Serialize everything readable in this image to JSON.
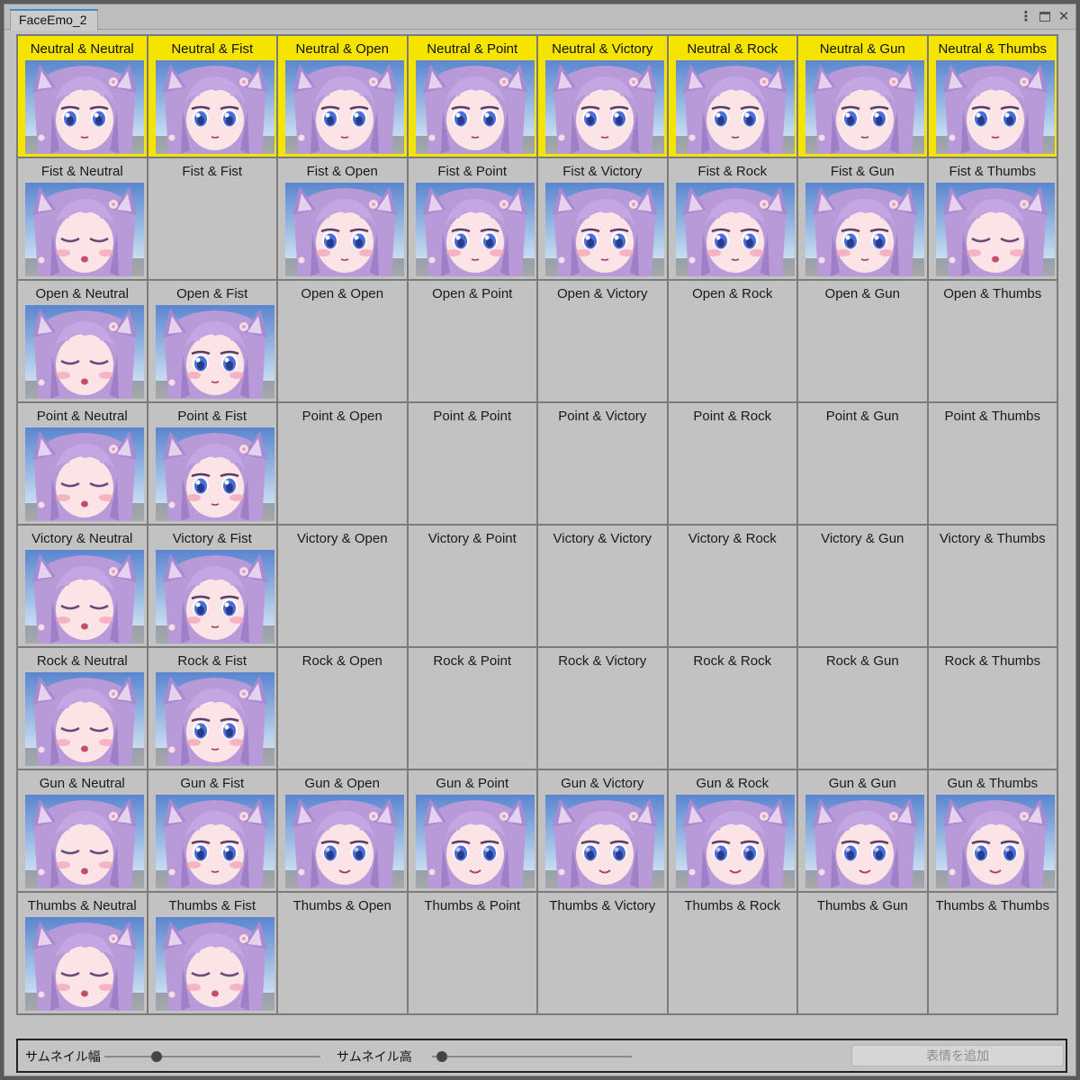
{
  "window": {
    "tab_title": "FaceEmo_2",
    "controls": [
      "kebab-menu-icon",
      "maximize-icon",
      "close-icon"
    ]
  },
  "colors": {
    "default_highlight": "#f5e400",
    "cell_background": "#c2c2c2",
    "grid_lines": "#7b7b7b"
  },
  "grid": {
    "cells": [
      {
        "label": "Neutral & Neutral",
        "thumbnail": true,
        "expression": "open-eyes",
        "default": true
      },
      {
        "label": "Neutral & Fist",
        "thumbnail": true,
        "expression": "open-eyes",
        "default": true
      },
      {
        "label": "Neutral & Open",
        "thumbnail": true,
        "expression": "open-eyes",
        "default": true
      },
      {
        "label": "Neutral & Point",
        "thumbnail": true,
        "expression": "open-eyes",
        "default": true
      },
      {
        "label": "Neutral & Victory",
        "thumbnail": true,
        "expression": "open-eyes",
        "default": true
      },
      {
        "label": "Neutral & Rock",
        "thumbnail": true,
        "expression": "open-eyes",
        "default": true
      },
      {
        "label": "Neutral & Gun",
        "thumbnail": true,
        "expression": "open-eyes",
        "default": true
      },
      {
        "label": "Neutral & Thumbs",
        "thumbnail": true,
        "expression": "open-eyes",
        "default": true
      },
      {
        "label": "Fist & Neutral",
        "thumbnail": true,
        "expression": "closed-eyes",
        "default": false
      },
      {
        "label": "Fist & Fist",
        "thumbnail": false,
        "expression": "",
        "default": false
      },
      {
        "label": "Fist & Open",
        "thumbnail": true,
        "expression": "blush",
        "default": false
      },
      {
        "label": "Fist & Point",
        "thumbnail": true,
        "expression": "blush",
        "default": false
      },
      {
        "label": "Fist & Victory",
        "thumbnail": true,
        "expression": "blush",
        "default": false
      },
      {
        "label": "Fist & Rock",
        "thumbnail": true,
        "expression": "blush",
        "default": false
      },
      {
        "label": "Fist & Gun",
        "thumbnail": true,
        "expression": "blush",
        "default": false
      },
      {
        "label": "Fist & Thumbs",
        "thumbnail": true,
        "expression": "closed-eyes",
        "default": false
      },
      {
        "label": "Open & Neutral",
        "thumbnail": true,
        "expression": "closed-eyes",
        "default": false
      },
      {
        "label": "Open & Fist",
        "thumbnail": true,
        "expression": "blush",
        "default": false
      },
      {
        "label": "Open & Open",
        "thumbnail": false,
        "expression": "",
        "default": false
      },
      {
        "label": "Open & Point",
        "thumbnail": false,
        "expression": "",
        "default": false
      },
      {
        "label": "Open & Victory",
        "thumbnail": false,
        "expression": "",
        "default": false
      },
      {
        "label": "Open & Rock",
        "thumbnail": false,
        "expression": "",
        "default": false
      },
      {
        "label": "Open & Gun",
        "thumbnail": false,
        "expression": "",
        "default": false
      },
      {
        "label": "Open & Thumbs",
        "thumbnail": false,
        "expression": "",
        "default": false
      },
      {
        "label": "Point & Neutral",
        "thumbnail": true,
        "expression": "closed-eyes",
        "default": false
      },
      {
        "label": "Point & Fist",
        "thumbnail": true,
        "expression": "blush",
        "default": false
      },
      {
        "label": "Point & Open",
        "thumbnail": false,
        "expression": "",
        "default": false
      },
      {
        "label": "Point & Point",
        "thumbnail": false,
        "expression": "",
        "default": false
      },
      {
        "label": "Point & Victory",
        "thumbnail": false,
        "expression": "",
        "default": false
      },
      {
        "label": "Point & Rock",
        "thumbnail": false,
        "expression": "",
        "default": false
      },
      {
        "label": "Point & Gun",
        "thumbnail": false,
        "expression": "",
        "default": false
      },
      {
        "label": "Point & Thumbs",
        "thumbnail": false,
        "expression": "",
        "default": false
      },
      {
        "label": "Victory & Neutral",
        "thumbnail": true,
        "expression": "closed-eyes",
        "default": false
      },
      {
        "label": "Victory & Fist",
        "thumbnail": true,
        "expression": "blush",
        "default": false
      },
      {
        "label": "Victory & Open",
        "thumbnail": false,
        "expression": "",
        "default": false
      },
      {
        "label": "Victory & Point",
        "thumbnail": false,
        "expression": "",
        "default": false
      },
      {
        "label": "Victory & Victory",
        "thumbnail": false,
        "expression": "",
        "default": false
      },
      {
        "label": "Victory & Rock",
        "thumbnail": false,
        "expression": "",
        "default": false
      },
      {
        "label": "Victory & Gun",
        "thumbnail": false,
        "expression": "",
        "default": false
      },
      {
        "label": "Victory & Thumbs",
        "thumbnail": false,
        "expression": "",
        "default": false
      },
      {
        "label": "Rock & Neutral",
        "thumbnail": true,
        "expression": "closed-eyes",
        "default": false
      },
      {
        "label": "Rock & Fist",
        "thumbnail": true,
        "expression": "blush",
        "default": false
      },
      {
        "label": "Rock & Open",
        "thumbnail": false,
        "expression": "",
        "default": false
      },
      {
        "label": "Rock & Point",
        "thumbnail": false,
        "expression": "",
        "default": false
      },
      {
        "label": "Rock & Victory",
        "thumbnail": false,
        "expression": "",
        "default": false
      },
      {
        "label": "Rock & Rock",
        "thumbnail": false,
        "expression": "",
        "default": false
      },
      {
        "label": "Rock & Gun",
        "thumbnail": false,
        "expression": "",
        "default": false
      },
      {
        "label": "Rock & Thumbs",
        "thumbnail": false,
        "expression": "",
        "default": false
      },
      {
        "label": "Gun & Neutral",
        "thumbnail": true,
        "expression": "closed-eyes",
        "default": false
      },
      {
        "label": "Gun & Fist",
        "thumbnail": true,
        "expression": "blush",
        "default": false
      },
      {
        "label": "Gun & Open",
        "thumbnail": true,
        "expression": "smile",
        "default": false
      },
      {
        "label": "Gun & Point",
        "thumbnail": true,
        "expression": "smile",
        "default": false
      },
      {
        "label": "Gun & Victory",
        "thumbnail": true,
        "expression": "smile",
        "default": false
      },
      {
        "label": "Gun & Rock",
        "thumbnail": true,
        "expression": "smile",
        "default": false
      },
      {
        "label": "Gun & Gun",
        "thumbnail": true,
        "expression": "smile",
        "default": false
      },
      {
        "label": "Gun & Thumbs",
        "thumbnail": true,
        "expression": "smile",
        "default": false
      },
      {
        "label": "Thumbs & Neutral",
        "thumbnail": true,
        "expression": "closed-eyes",
        "default": false
      },
      {
        "label": "Thumbs & Fist",
        "thumbnail": true,
        "expression": "closed-eyes",
        "default": false
      },
      {
        "label": "Thumbs & Open",
        "thumbnail": false,
        "expression": "",
        "default": false
      },
      {
        "label": "Thumbs & Point",
        "thumbnail": false,
        "expression": "",
        "default": false
      },
      {
        "label": "Thumbs & Victory",
        "thumbnail": false,
        "expression": "",
        "default": false
      },
      {
        "label": "Thumbs & Rock",
        "thumbnail": false,
        "expression": "",
        "default": false
      },
      {
        "label": "Thumbs & Gun",
        "thumbnail": false,
        "expression": "",
        "default": false
      },
      {
        "label": "Thumbs & Thumbs",
        "thumbnail": false,
        "expression": "",
        "default": false
      }
    ]
  },
  "toolbar": {
    "width_label": "サムネイル幅",
    "height_label": "サムネイル高",
    "width_slider_value": 0.24,
    "height_slider_value": 0.05,
    "add_button_label": "表情を追加"
  }
}
